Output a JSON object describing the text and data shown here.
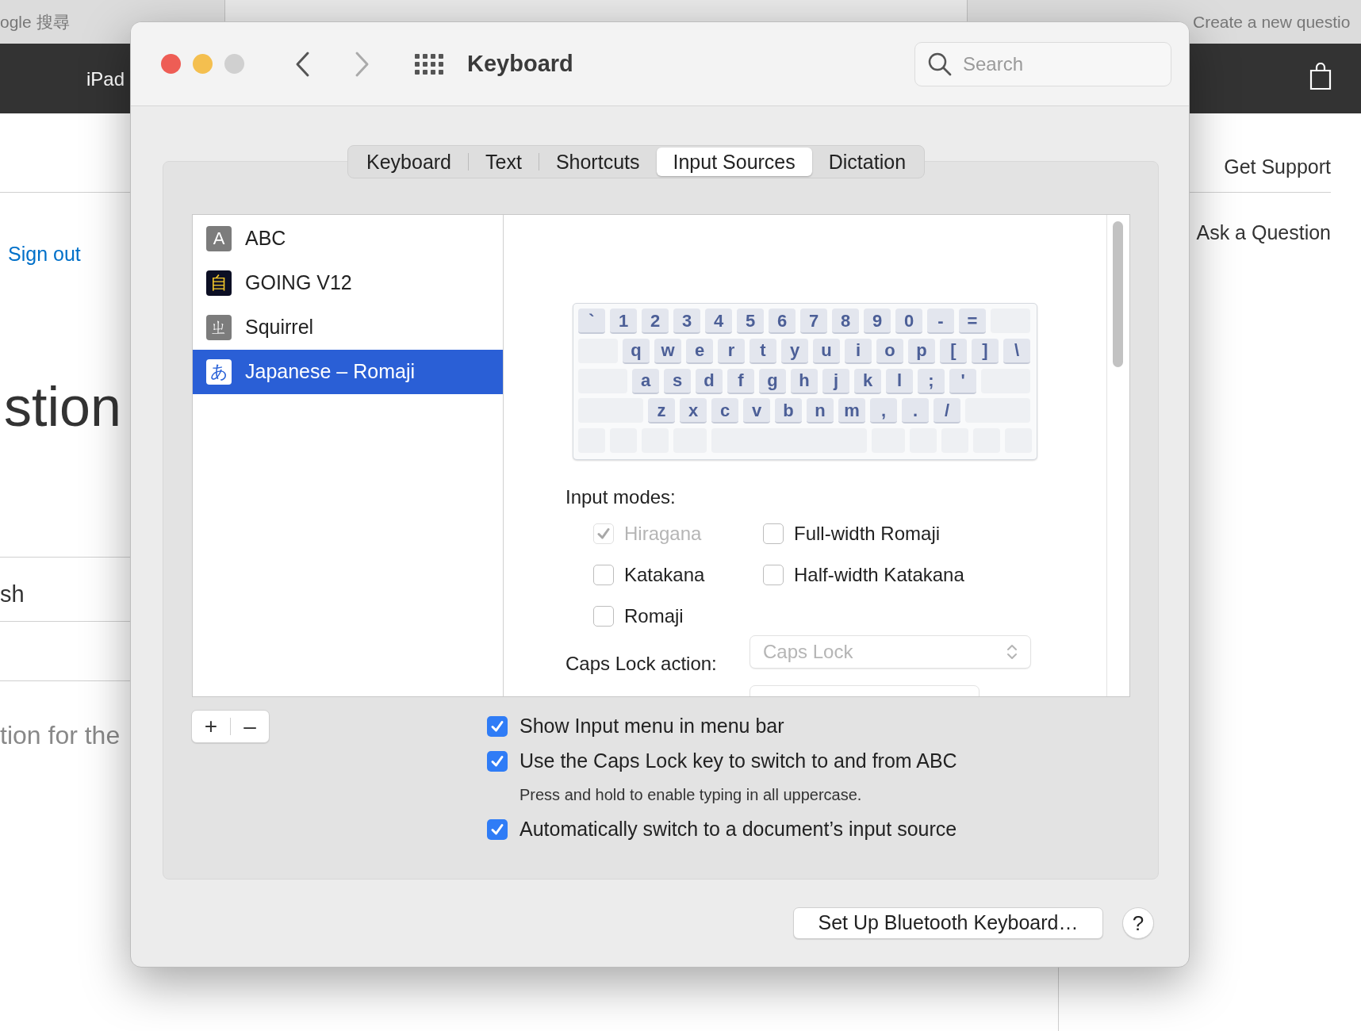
{
  "browser": {
    "tabs": [
      {
        "label": "ogle 搜尋",
        "selected": false
      },
      {
        "label": "Create a new questio",
        "selected": false
      }
    ],
    "nav": {
      "label": "iPad"
    }
  },
  "page_behind": {
    "left_texts": [
      {
        "kind": "link",
        "text": "Sign out"
      },
      {
        "kind": "title",
        "text": "stion"
      },
      {
        "kind": "row",
        "text": "sh"
      },
      {
        "kind": "hint",
        "text": "tion for the"
      }
    ],
    "right_links": [
      "Get Support",
      "Ask a Question"
    ]
  },
  "window": {
    "title": "Keyboard",
    "search": {
      "placeholder": "Search"
    },
    "tabs": [
      {
        "label": "Keyboard",
        "selected": false
      },
      {
        "label": "Text",
        "selected": false
      },
      {
        "label": "Shortcuts",
        "selected": false
      },
      {
        "label": "Input Sources",
        "selected": true
      },
      {
        "label": "Dictation",
        "selected": false
      }
    ],
    "sources": [
      {
        "name": "ABC",
        "kind": "gray",
        "glyph": "A",
        "selected": false
      },
      {
        "name": "GOING V12",
        "kind": "dark",
        "glyph": "自",
        "selected": false
      },
      {
        "name": "Squirrel",
        "kind": "gray",
        "glyph": "ㄓ",
        "selected": false
      },
      {
        "name": "Japanese – Romaji",
        "kind": "light",
        "glyph": "あ",
        "selected": true
      }
    ],
    "keyboard": {
      "rows": [
        [
          "`",
          "1",
          "2",
          "3",
          "4",
          "5",
          "6",
          "7",
          "8",
          "9",
          "0",
          "-",
          "="
        ],
        [
          "q",
          "w",
          "e",
          "r",
          "t",
          "y",
          "u",
          "i",
          "o",
          "p",
          "[",
          "]",
          "\\"
        ],
        [
          "a",
          "s",
          "d",
          "f",
          "g",
          "h",
          "j",
          "k",
          "l",
          ";",
          "'"
        ],
        [
          "z",
          "x",
          "c",
          "v",
          "b",
          "n",
          "m",
          ",",
          ".",
          "/"
        ]
      ]
    },
    "input_modes": {
      "label": "Input modes:",
      "items": [
        {
          "label": "Hiragana",
          "checked": true,
          "disabled": true
        },
        {
          "label": "Full-width Romaji",
          "checked": false,
          "disabled": false
        },
        {
          "label": "Katakana",
          "checked": false,
          "disabled": false
        },
        {
          "label": "Half-width Katakana",
          "checked": false,
          "disabled": false
        },
        {
          "label": "Romaji",
          "checked": false,
          "disabled": false
        }
      ]
    },
    "caps_lock_action": {
      "label": "Caps Lock action:",
      "value": "Caps Lock",
      "disabled": true
    },
    "add_button": "+",
    "remove_button": "–",
    "options": [
      {
        "label": "Show Input menu in menu bar",
        "checked": true
      },
      {
        "label": "Use the Caps Lock key to switch to and from ABC",
        "checked": true,
        "note": "Press and hold to enable typing in all uppercase."
      },
      {
        "label": "Automatically switch to a document’s input source",
        "checked": true
      }
    ],
    "bluetooth_button": "Set Up Bluetooth Keyboard…",
    "help_button": "?"
  }
}
